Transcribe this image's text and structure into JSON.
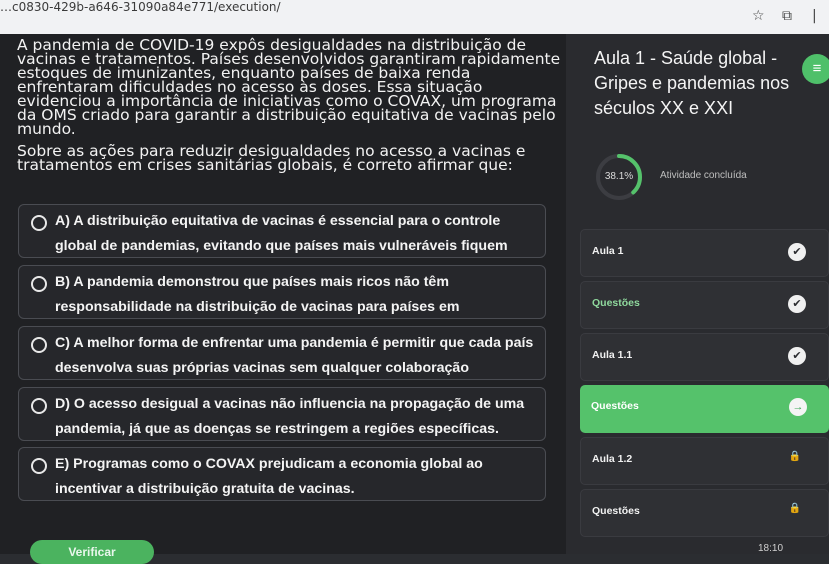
{
  "browser": {
    "url": "…c0830-429b-a646-31090a84e771/execution/",
    "star_icon": "star-icon",
    "extensions_icon": "puzzle-icon"
  },
  "main": {
    "intro": "A pandemia de COVID-19 expôs desigualdades na distribuição de vacinas e tratamentos. Países desenvolvidos garantiram rapidamente estoques de imunizantes, enquanto países de baixa renda enfrentaram dificuldades no acesso às doses. Essa situação evidenciou a importância de iniciativas como o COVAX, um programa da OMS criado para garantir a distribuição equitativa de vacinas pelo mundo.",
    "question": "Sobre as ações para reduzir desigualdades no acesso a vacinas e tratamentos em crises sanitárias globais, é correto afirmar que:",
    "options": [
      {
        "text": "A) A distribuição equitativa de vacinas é essencial para o controle global de pandemias, evitando que países mais vulneráveis fiquem desprotegidos."
      },
      {
        "text": "B) A pandemia demonstrou que países mais ricos não têm responsabilidade na distribuição de vacinas para países em desenvolvimento."
      },
      {
        "text": "C) A melhor forma de enfrentar uma pandemia é permitir que cada país desenvolva suas próprias vacinas sem qualquer colaboração internacional."
      },
      {
        "text": "D) O acesso desigual a vacinas não influencia na propagação de uma pandemia, já que as doenças se restringem a regiões específicas."
      },
      {
        "text": "E) Programas como o COVAX prejudicam a economia global ao incentivar a distribuição gratuita de vacinas."
      }
    ],
    "verify_label": "Verificar"
  },
  "sidebar": {
    "course_title": "Aula 1 - Saúde global - Gripes e pandemias nos séculos XX e XXI",
    "progress": {
      "percent": 38.1,
      "percent_label": "38.1%",
      "status": "Atividade concluída"
    },
    "items": [
      {
        "label": "Aula 1",
        "state": "done"
      },
      {
        "label": "Questões",
        "state": "done"
      },
      {
        "label": "Aula 1.1",
        "state": "done"
      },
      {
        "label": "Questões",
        "state": "current"
      },
      {
        "label": "Aula 1.2",
        "state": "locked"
      },
      {
        "label": "Questões",
        "state": "locked"
      }
    ]
  },
  "system": {
    "clock": "18:10"
  },
  "colors": {
    "accent": "#55c26b",
    "background": "#202124",
    "panel": "#2a2b2f"
  }
}
